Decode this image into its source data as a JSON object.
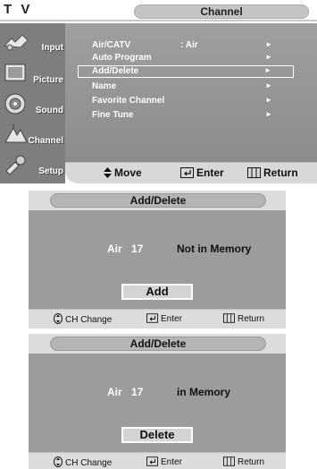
{
  "tv_menu": {
    "logo": "T V",
    "title": "Channel",
    "sidebar": [
      {
        "label": "Input",
        "icon": "input-icon"
      },
      {
        "label": "Picture",
        "icon": "picture-icon"
      },
      {
        "label": "Sound",
        "icon": "sound-icon"
      },
      {
        "label": "Channel",
        "icon": "channel-icon"
      },
      {
        "label": "Setup",
        "icon": "setup-icon"
      }
    ],
    "items": [
      {
        "label": "Air/CATV",
        "value": ":   Air",
        "arrow": "►"
      },
      {
        "label": "Auto Program",
        "value": "",
        "arrow": "►"
      },
      {
        "label": "Add/Delete",
        "value": "",
        "arrow": "►"
      },
      {
        "label": "Name",
        "value": "",
        "arrow": "►"
      },
      {
        "label": "Favorite  Channel",
        "value": "",
        "arrow": "►"
      },
      {
        "label": "Fine Tune",
        "value": "",
        "arrow": "►"
      }
    ],
    "footer": {
      "move": "Move",
      "enter": "Enter",
      "return": "Return"
    },
    "colors": {
      "sidebar": "#7e7e7e",
      "main": "#9a9a9a",
      "footer": "#d8d8d8"
    }
  },
  "dialogs": [
    {
      "title": "Add/Delete",
      "source": "Air",
      "channel": "17",
      "status": "Not in Memory",
      "button": "Add",
      "footer": {
        "ch_change": "CH Change",
        "enter": "Enter",
        "return": "Return"
      }
    },
    {
      "title": "Add/Delete",
      "source": "Air",
      "channel": "17",
      "status": "in Memory",
      "button": "Delete",
      "footer": {
        "ch_change": "CH Change",
        "enter": "Enter",
        "return": "Return"
      }
    }
  ]
}
